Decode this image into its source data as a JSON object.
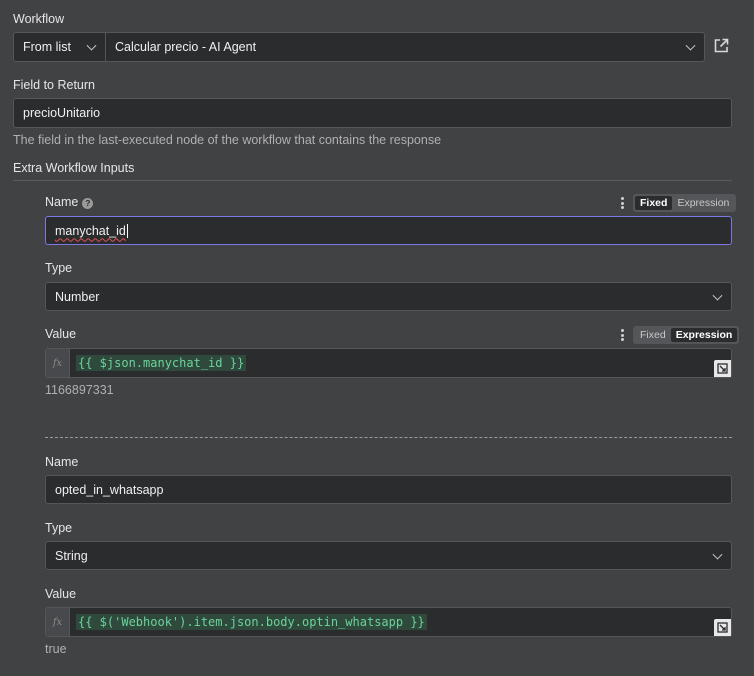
{
  "workflow": {
    "label": "Workflow",
    "source_select": "From list",
    "workflow_select": "Calcular precio - AI Agent",
    "open_icon": "external-link-icon"
  },
  "field_to_return": {
    "label": "Field to Return",
    "value": "precioUnitario",
    "hint": "The field in the last-executed node of the workflow that contains the response"
  },
  "extra_inputs": {
    "label": "Extra Workflow Inputs",
    "items": [
      {
        "name_label": "Name",
        "name_value": "manychat_id",
        "name_mode": "Fixed",
        "toggle": [
          "Fixed",
          "Expression"
        ],
        "type_label": "Type",
        "type_value": "Number",
        "value_label": "Value",
        "value_mode": "Expression",
        "value_expr": "{{ $json.manychat_id }}",
        "value_result": "1166897331"
      },
      {
        "name_label": "Name",
        "name_value": "opted_in_whatsapp",
        "type_label": "Type",
        "type_value": "String",
        "value_label": "Value",
        "value_expr": "{{ $('Webhook').item.json.body.optin_whatsapp }}",
        "value_result": "true"
      }
    ]
  },
  "fx_label": "fx",
  "colors": {
    "background": "#414244",
    "input_bg": "#2b2c2e",
    "focus_border": "#7b78e6",
    "expression_text": "#6bd39b"
  }
}
